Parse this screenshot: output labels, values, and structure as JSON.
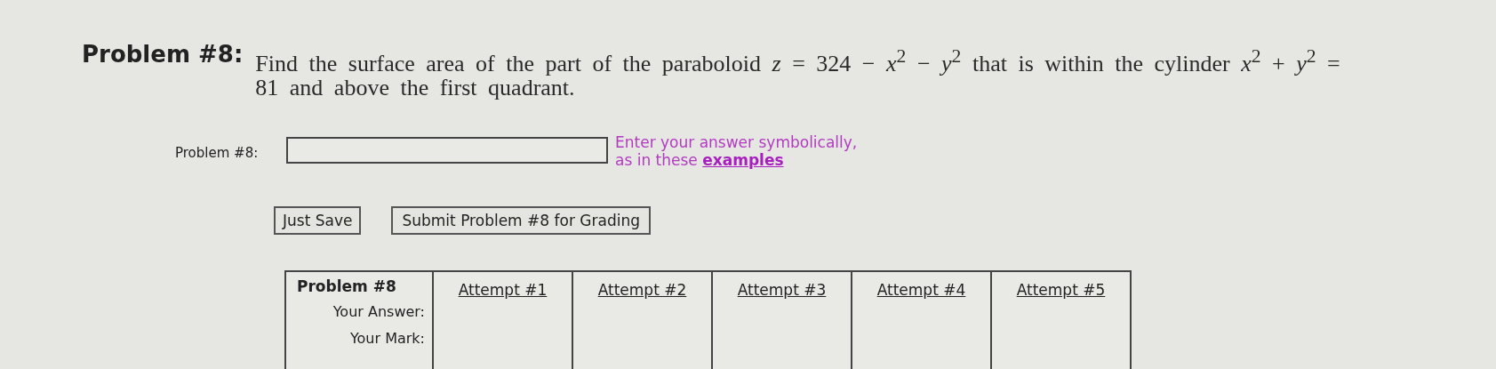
{
  "problem": {
    "heading": "Problem #8:",
    "statement": "Find the surface area of the part of the paraboloid *z* = 324 − *x*$^{2}$ − *y*$^{2}$ that is within the cylinder *x*$^{2}$ + *y*$^{2}$ = 81 and above the first quadrant."
  },
  "answer": {
    "label": "Problem #8:",
    "hint": "Enter your answer symbolically,",
    "hint_line2": "as in these",
    "link": "examples"
  },
  "buttons": [
    "Just Save",
    "Submit Problem #8 for Grading"
  ],
  "attempts_table": {
    "header": "Problem #8",
    "row_labels": [
      "Your Answer:",
      "Your Mark:"
    ],
    "attempts": [
      "Attempt #1",
      "Attempt #2",
      "Attempt #3",
      "Attempt #4",
      "Attempt #5"
    ]
  }
}
